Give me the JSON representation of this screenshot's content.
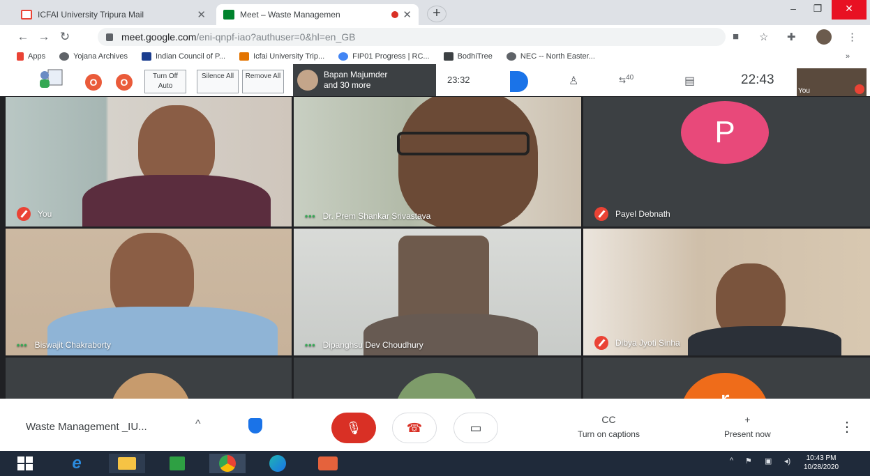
{
  "browser": {
    "tabs": [
      {
        "title": "ICFAI University Tripura Mail",
        "state": "inactive"
      },
      {
        "title": "Meet – Waste Managemen",
        "state": "active",
        "recording": true
      }
    ],
    "new_tab": "+",
    "window": {
      "minimize": "–",
      "restore": "❐",
      "close": "✕"
    },
    "url": {
      "host": "meet.google.com",
      "path": "/eni-qnpf-iao?authuser=0&hl=en_GB"
    },
    "bookmarks": [
      {
        "label": "Apps",
        "icon": "apps-grid-icon",
        "color": "#ea4335"
      },
      {
        "label": "Yojana Archives",
        "icon": "globe-icon",
        "color": "#5f6368"
      },
      {
        "label": "Indian Council of P...",
        "icon": "icpr-icon",
        "color": "#1a3d8f"
      },
      {
        "label": "Icfai University Trip...",
        "icon": "icfai-icon",
        "color": "#e37400"
      },
      {
        "label": "FIP01 Progress | RC...",
        "icon": "fip-icon",
        "color": "#4285f4"
      },
      {
        "label": "BodhiTree",
        "icon": "bodhitree-icon",
        "color": "#3c4043"
      },
      {
        "label": "NEC -- North Easter...",
        "icon": "globe-icon",
        "color": "#5f6368"
      }
    ],
    "more_bookmarks": "»"
  },
  "meet": {
    "extension_buttons": [
      {
        "label": "Turn Off Auto"
      },
      {
        "label": "Silence All"
      },
      {
        "label": "Remove All"
      }
    ],
    "presenter_strip": {
      "line1": "Bapan Majumder",
      "line2": "and 30 more"
    },
    "stats": {
      "elapsed": "23:32",
      "participant_count": "40",
      "clock": "22:43"
    },
    "self_view": {
      "label": "You"
    },
    "tiles": [
      {
        "name": "You",
        "status": "muted"
      },
      {
        "name": "Dr. Prem Shankar Srivastava",
        "status": "speaking"
      },
      {
        "name": "Payel Debnath",
        "status": "muted",
        "avatar_letter": "P",
        "avatar_color": "#e8497a"
      },
      {
        "name": "Biswajit Chakraborty",
        "status": "speaking"
      },
      {
        "name": "Dipanghsu Dev Choudhury",
        "status": "speaking"
      },
      {
        "name": "Dibya Jyoti Sinha",
        "status": "muted"
      },
      {
        "name": "",
        "status": "partial"
      },
      {
        "name": "",
        "status": "partial"
      },
      {
        "name": "",
        "status": "partial",
        "avatar_letter": "r",
        "avatar_color": "#ef6c1a"
      }
    ],
    "controls": {
      "meeting_name": "Waste Management _IU...",
      "chevron": "^",
      "captions_label": "Turn on captions",
      "captions_icon": "CC",
      "present_label": "Present now",
      "present_icon": "+",
      "more": "⋮"
    }
  },
  "taskbar": {
    "time": "10:43 PM",
    "date": "10/28/2020"
  },
  "colors": {
    "meet_dark": "#202124",
    "danger": "#d93025",
    "accent": "#1a73e8",
    "taskbar": "#1f2a3a"
  }
}
